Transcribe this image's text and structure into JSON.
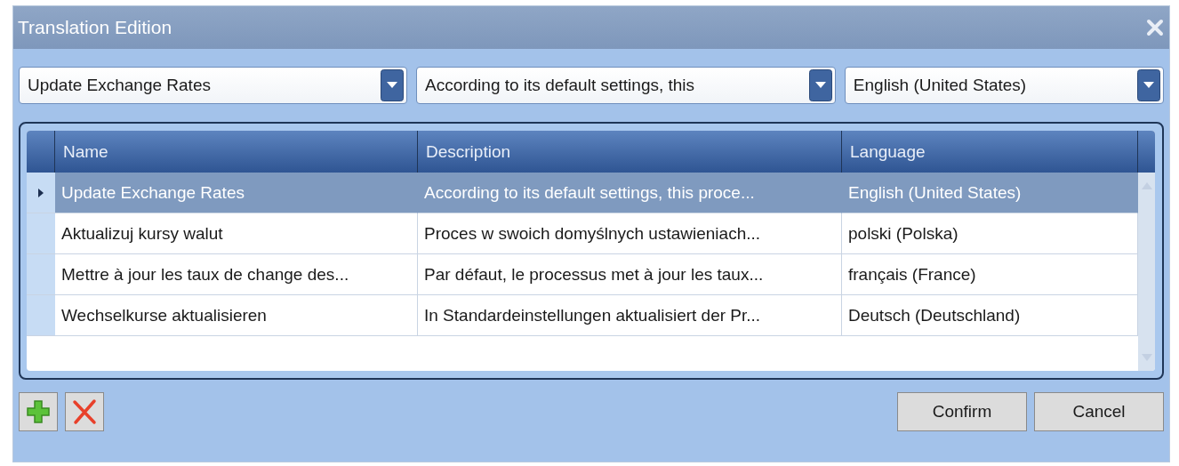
{
  "window": {
    "title": "Translation Edition"
  },
  "filters": [
    {
      "value": "Update Exchange Rates"
    },
    {
      "value": "According to its default settings, this"
    },
    {
      "value": "English (United States)"
    }
  ],
  "table": {
    "columns": [
      "Name",
      "Description",
      "Language"
    ],
    "rows": [
      {
        "selected": true,
        "cells": [
          "Update Exchange Rates",
          "According to its default settings, this proce...",
          "English (United States)"
        ]
      },
      {
        "selected": false,
        "cells": [
          "Aktualizuj kursy walut",
          "Proces w swoich domyślnych ustawieniach...",
          "polski (Polska)"
        ]
      },
      {
        "selected": false,
        "cells": [
          "Mettre à jour les taux de change des...",
          "Par défaut, le processus met à jour les taux...",
          "français (France)"
        ]
      },
      {
        "selected": false,
        "cells": [
          "Wechselkurse aktualisieren",
          "In Standardeinstellungen aktualisiert der Pr...",
          "Deutsch (Deutschland)"
        ]
      }
    ]
  },
  "buttons": [
    "Confirm",
    "Cancel"
  ]
}
